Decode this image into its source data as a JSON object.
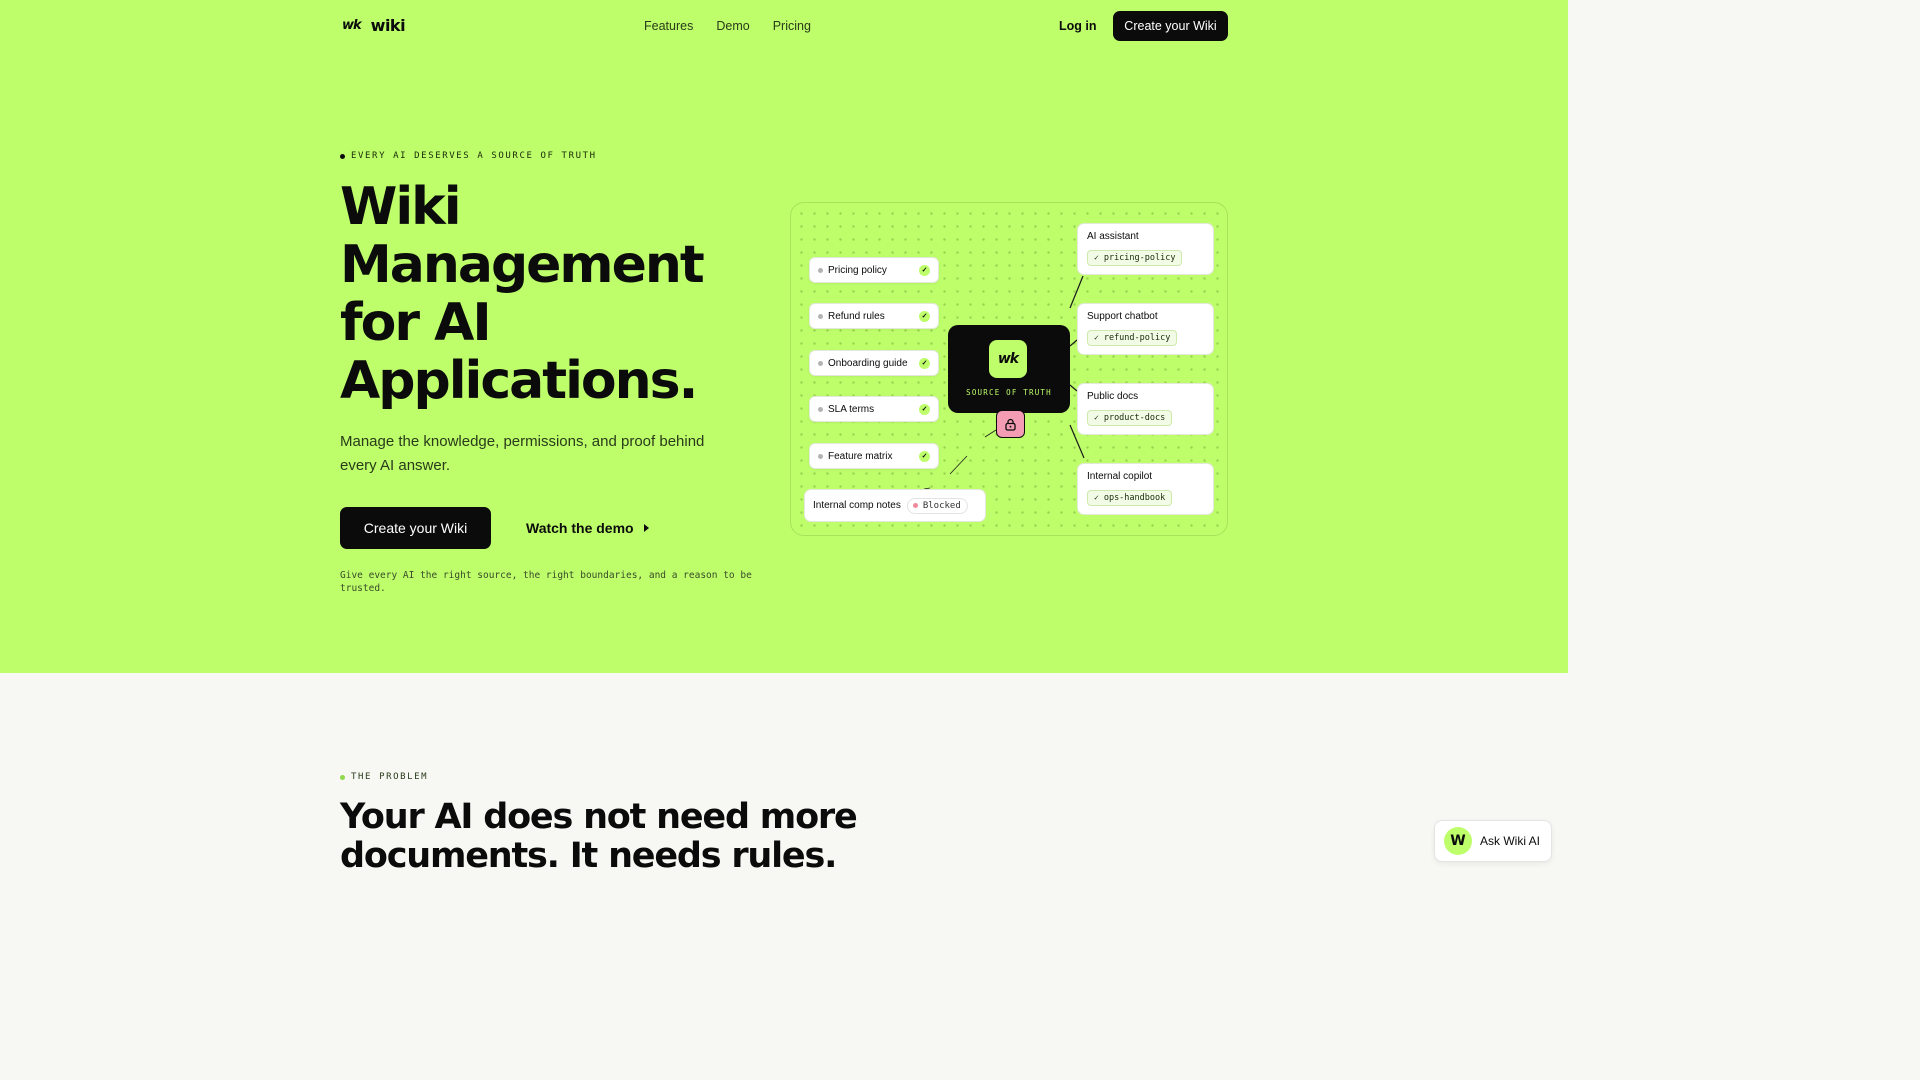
{
  "nav": {
    "logo_mark": "wk",
    "logo_text": "wiki",
    "links": [
      "Features",
      "Demo",
      "Pricing"
    ],
    "login": "Log in",
    "cta": "Create your Wiki"
  },
  "hero": {
    "eyebrow": "EVERY AI DESERVES A SOURCE OF TRUTH",
    "headline": "Wiki Management for AI Applications.",
    "subhead": "Manage the knowledge, permissions, and proof behind every AI answer.",
    "cta": "Create your Wiki",
    "watch": "Watch the demo",
    "note": "Give every AI the right source, the right boundaries, and a reason to be trusted."
  },
  "diagram": {
    "sources": [
      "Pricing policy",
      "Refund rules",
      "Onboarding guide",
      "SLA terms",
      "Feature matrix"
    ],
    "blocked_source": "Internal comp notes",
    "blocked_label": "Blocked",
    "hub_mark": "wk",
    "hub_label": "SOURCE OF TRUTH",
    "outputs": [
      {
        "title": "AI assistant",
        "tag": "pricing-policy"
      },
      {
        "title": "Support chatbot",
        "tag": "refund-policy"
      },
      {
        "title": "Public docs",
        "tag": "product-docs"
      },
      {
        "title": "Internal copilot",
        "tag": "ops-handbook"
      }
    ],
    "icons": {
      "check": "check-icon",
      "lock": "lock-icon"
    }
  },
  "problem": {
    "eyebrow": "THE PROBLEM",
    "headline": "Your AI does not need more documents. It needs rules."
  },
  "chat_widget": {
    "avatar": "W",
    "label": "Ask Wiki AI"
  },
  "colors": {
    "accent": "#bdfe6a",
    "ink": "#0b0b0b",
    "section_bg": "#f7f7f3",
    "blocked": "#f39cb3"
  }
}
